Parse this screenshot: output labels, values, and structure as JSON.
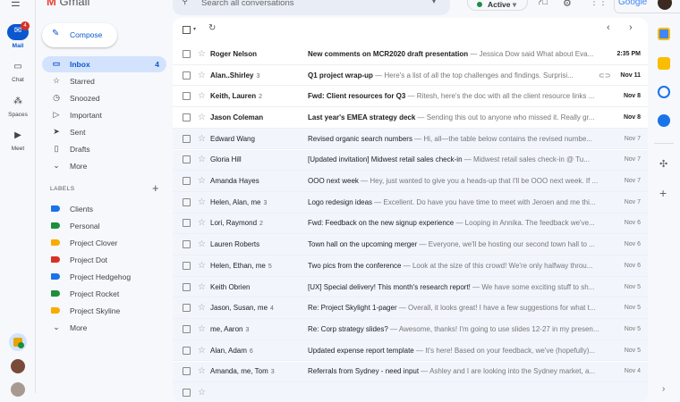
{
  "app": {
    "logo_text": "Gmail",
    "search_placeholder": "Search all conversations",
    "status": "Active",
    "google": "Google"
  },
  "rail": [
    {
      "label": "Mail",
      "badge": "4"
    },
    {
      "label": "Chat"
    },
    {
      "label": "Spaces"
    },
    {
      "label": "Meet"
    }
  ],
  "compose": "Compose",
  "nav": [
    {
      "label": "Inbox",
      "count": "4",
      "icon": "inbox-icon",
      "g": "▭"
    },
    {
      "label": "Starred",
      "icon": "star-icon",
      "g": "☆"
    },
    {
      "label": "Snoozed",
      "icon": "clock-icon",
      "g": "◷"
    },
    {
      "label": "Important",
      "icon": "important-icon",
      "g": "▷"
    },
    {
      "label": "Sent",
      "icon": "send-icon",
      "g": "➤"
    },
    {
      "label": "Drafts",
      "icon": "draft-icon",
      "g": "▯"
    },
    {
      "label": "More",
      "icon": "chevron-down-icon",
      "g": "⌄"
    }
  ],
  "labels_header": "LABELS",
  "labels": [
    {
      "name": "Clients",
      "color": "#1a73e8"
    },
    {
      "name": "Personal",
      "color": "#1e8e3e"
    },
    {
      "name": "Project Clover",
      "color": "#f9ab00"
    },
    {
      "name": "Project Dot",
      "color": "#d93025"
    },
    {
      "name": "Project Hedgehog",
      "color": "#1a73e8"
    },
    {
      "name": "Project Rocket",
      "color": "#1e8e3e"
    },
    {
      "name": "Project Skyline",
      "color": "#f9ab00"
    }
  ],
  "labels_more": "More",
  "emails": [
    {
      "sender": "Roger Nelson",
      "count": "",
      "subject": "New comments on MCR2020 draft presentation",
      "preview": " — Jessica Dow said What about Eva...",
      "date": "2:35 PM",
      "unread": true
    },
    {
      "sender": "Alan..Shirley",
      "count": "3",
      "subject": "Q1 project wrap-up ",
      "preview": " — Here's a list of all the top challenges and findings. Surprisi...",
      "date": "Nov 11",
      "unread": true,
      "attachment": true
    },
    {
      "sender": "Keith, Lauren",
      "count": "2",
      "subject": "Fwd: Client resources for Q3",
      "preview": " — Ritesh, here's the doc with all the client resource links ...",
      "date": "Nov 8",
      "unread": true
    },
    {
      "sender": "Jason Coleman",
      "count": "",
      "subject": "Last year's EMEA strategy deck",
      "preview": " — Sending this out to anyone who missed it. Really gr...",
      "date": "Nov 8",
      "unread": true
    },
    {
      "sender": "Edward Wang",
      "count": "",
      "subject": "Revised organic search numbers",
      "preview": " — Hi, all—the table below contains the revised numbe...",
      "date": "Nov 7",
      "unread": false
    },
    {
      "sender": "Gloria Hill",
      "count": "",
      "subject": "[Updated invitation] Midwest retail sales check-in",
      "preview": " — Midwest retail sales check-in @ Tu...",
      "date": "Nov 7",
      "unread": false
    },
    {
      "sender": "Amanda Hayes",
      "count": "",
      "subject": "OOO next week",
      "preview": " — Hey, just wanted to give you a heads-up that I'll be OOO next week. If ...",
      "date": "Nov 7",
      "unread": false
    },
    {
      "sender": "Helen, Alan, me",
      "count": "3",
      "subject": "Logo redesign ideas",
      "preview": " — Excellent. Do have you have time to meet with Jeroen and me thi...",
      "date": "Nov 7",
      "unread": false
    },
    {
      "sender": "Lori, Raymond",
      "count": "2",
      "subject": "Fwd: Feedback on the new signup experience",
      "preview": " — Looping in Annika. The feedback we've...",
      "date": "Nov 6",
      "unread": false
    },
    {
      "sender": "Lauren Roberts",
      "count": "",
      "subject": "Town hall on the upcoming merger",
      "preview": " — Everyone, we'll be hosting our second town hall to ...",
      "date": "Nov 6",
      "unread": false
    },
    {
      "sender": "Helen, Ethan, me",
      "count": "5",
      "subject": "Two pics from the conference",
      "preview": " — Look at the size of this crowd! We're only halfway throu...",
      "date": "Nov 6",
      "unread": false
    },
    {
      "sender": "Keith Obrien",
      "count": "",
      "subject": "[UX] Special delivery! This month's research report!",
      "preview": " — We have some exciting stuff to sh...",
      "date": "Nov 5",
      "unread": false
    },
    {
      "sender": "Jason, Susan, me",
      "count": "4",
      "subject": "Re: Project Skylight 1-pager",
      "preview": " — Overall, it looks great! I have a few suggestions for what t...",
      "date": "Nov 5",
      "unread": false
    },
    {
      "sender": "me, Aaron",
      "count": "3",
      "subject": "Re: Corp strategy slides?",
      "preview": " — Awesome, thanks! I'm going to use slides 12-27 in my presen...",
      "date": "Nov 5",
      "unread": false
    },
    {
      "sender": "Alan, Adam",
      "count": "6",
      "subject": "Updated expense report template",
      "preview": " — It's here! Based on your feedback, we've (hopefully)...",
      "date": "Nov 5",
      "unread": false
    },
    {
      "sender": "Amanda, me, Tom",
      "count": "3",
      "subject": "Referrals from Sydney - need input",
      "preview": " — Ashley and I are looking into the Sydney market, a...",
      "date": "Nov 4",
      "unread": false
    }
  ]
}
